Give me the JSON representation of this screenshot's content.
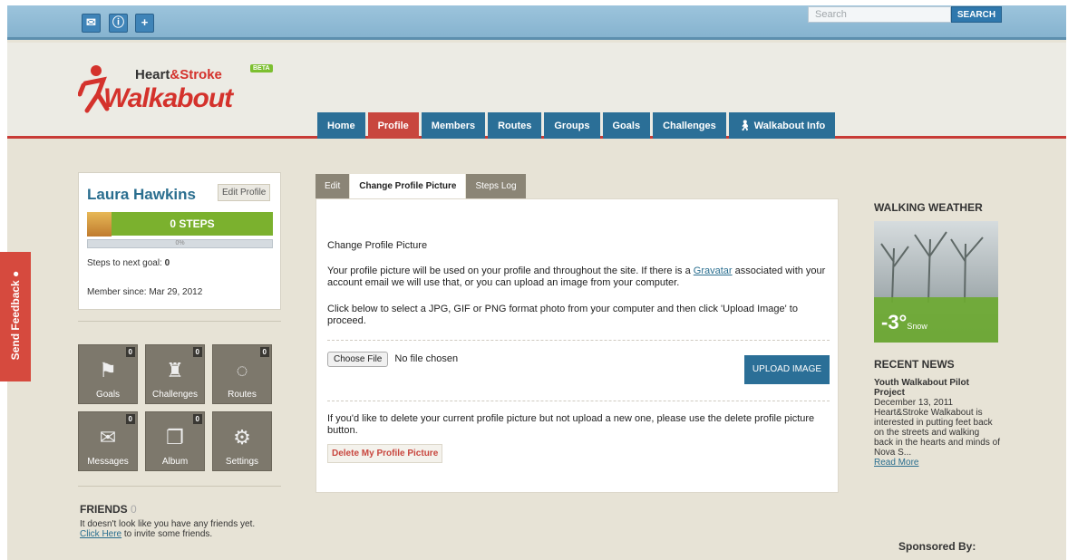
{
  "topbar": {
    "icons": [
      "mail-icon",
      "alert-icon",
      "plus-icon"
    ],
    "search_placeholder": "Search",
    "search_button": "SEARCH"
  },
  "brand": {
    "heart": "Heart",
    "amp_stroke": "&Stroke",
    "beta": "BETA",
    "walkabout": "Walkabout"
  },
  "nav": [
    "Home",
    "Profile",
    "Members",
    "Routes",
    "Groups",
    "Goals",
    "Challenges",
    "Walkabout Info"
  ],
  "profile": {
    "name": "Laura Hawkins",
    "edit_label": "Edit Profile",
    "steps": "0 STEPS",
    "progress_text": "0%",
    "progress_fraction": 0,
    "steps_to_goal_label": "Steps to next goal:",
    "steps_to_goal_value": "0",
    "member_since": "Member since: Mar 29, 2012"
  },
  "tiles": [
    {
      "label": "Goals",
      "count": "0"
    },
    {
      "label": "Challenges",
      "count": "0"
    },
    {
      "label": "Routes",
      "count": "0"
    },
    {
      "label": "Messages",
      "count": "0"
    },
    {
      "label": "Album",
      "count": "0"
    },
    {
      "label": "Settings",
      "count": ""
    }
  ],
  "friends": {
    "heading": "FRIENDS",
    "count": "0",
    "line1": "It doesn't look like you have any friends yet.",
    "link": "Click Here",
    "line2": "to invite some friends."
  },
  "center": {
    "tabs": [
      "Edit",
      "Change Profile Picture",
      "Steps Log"
    ],
    "title": "Change Profile Picture",
    "p1_a": "Your profile picture will be used on your profile and throughout the site. If there is a",
    "p1_link": "Gravatar",
    "p1_b": "associated with your account email we will use that, or you can upload an image from your computer.",
    "p2": "Click below to select a JPG, GIF or PNG format photo from your computer and then click 'Upload Image' to proceed.",
    "choose_file": "Choose File",
    "no_file": "No file chosen",
    "upload": "UPLOAD IMAGE",
    "p3": "If you'd like to delete your current profile picture but not upload a new one, please use the delete profile picture button.",
    "delete": "Delete My Profile Picture"
  },
  "weather": {
    "heading": "WALKING WEATHER",
    "temp": "-3°",
    "condition": "Snow"
  },
  "news": {
    "heading": "RECENT NEWS",
    "title": "Youth Walkabout Pilot Project",
    "date": "December 13, 2011",
    "body": "Heart&Stroke Walkabout is interested in putting feet back on the streets and walking back in the hearts and minds of Nova S...",
    "more": "Read More"
  },
  "sponsored": "Sponsored By:",
  "feedback": "Send Feedback"
}
